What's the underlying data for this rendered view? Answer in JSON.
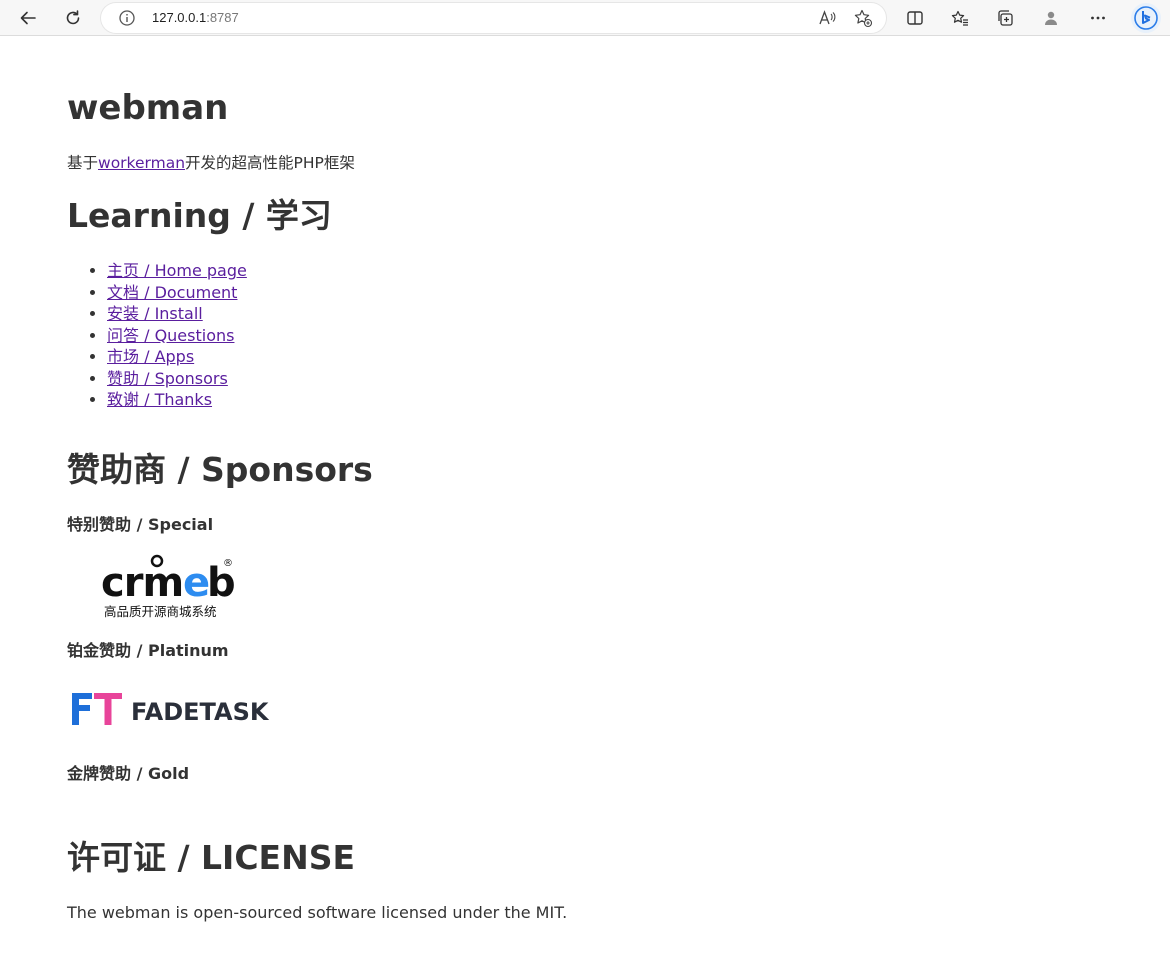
{
  "browser": {
    "url_host": "127.0.0.1",
    "url_port": ":8787",
    "icons": [
      "back-icon",
      "refresh-icon",
      "info-icon",
      "read-aloud-icon",
      "add-favorite-icon",
      "split-screen-icon",
      "favorites-icon",
      "collections-icon",
      "profile-icon",
      "more-icon",
      "bing-icon"
    ]
  },
  "page": {
    "title": "webman",
    "intro_prefix": "基于",
    "intro_link": "workerman",
    "intro_suffix": "开发的超高性能PHP框架",
    "learning_heading": "Learning / 学习",
    "links": [
      {
        "label": "主页 / Home page"
      },
      {
        "label": "文档 / Document"
      },
      {
        "label": "安装 / Install"
      },
      {
        "label": "问答 / Questions"
      },
      {
        "label": "市场 / Apps"
      },
      {
        "label": "赞助 / Sponsors"
      },
      {
        "label": "致谢 / Thanks"
      }
    ],
    "sponsors_heading": "赞助商 / Sponsors",
    "special_label": "特别赞助 / Special",
    "crmeb_logo_text": "crmeb",
    "crmeb_tagline": "高品质开源商城系统",
    "platinum_label": "铂金赞助 / Platinum",
    "fadetask_logo_text": "FADETASK",
    "gold_label": "金牌赞助 / Gold",
    "license_heading": "许可证 / LICENSE",
    "license_text": "The webman is open-sourced software licensed under the MIT."
  },
  "colors": {
    "link": "#5a1e9e",
    "text": "#333333",
    "fadetask_blue": "#1e6fd9",
    "fadetask_pink": "#e8449a",
    "crmeb_blue": "#2d8cf0"
  }
}
